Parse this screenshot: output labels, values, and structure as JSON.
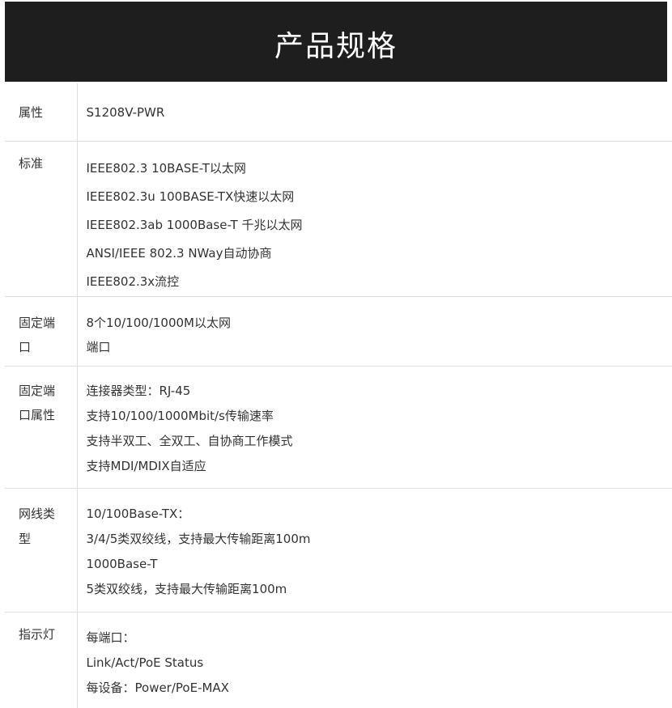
{
  "banner": {
    "title": "产品规格"
  },
  "rows": [
    {
      "attr": [
        "属性"
      ],
      "lines": [
        "S1208V-PWR"
      ]
    },
    {
      "attr": [
        "标准"
      ],
      "lines": [
        "IEEE802.3 10BASE-T以太网",
        "IEEE802.3u 100BASE-TX快速以太网",
        "IEEE802.3ab 1000Base-T 千兆以太网",
        "ANSI/IEEE 802.3 NWay自动协商",
        "IEEE802.3x流控"
      ]
    },
    {
      "attr": [
        "固定端",
        "口"
      ],
      "lines": [
        "8个10/100/1000M以太网",
        "端口"
      ]
    },
    {
      "attr": [
        "固定端",
        "口属性"
      ],
      "lines": [
        "连接器类型：RJ-45",
        "支持10/100/1000Mbit/s传输速率",
        "支持半双工、全双工、自协商工作模式",
        "支持MDI/MDIX自适应"
      ]
    },
    {
      "attr": [
        "网线类",
        "型"
      ],
      "lines": [
        "10/100Base-TX：",
        "3/4/5类双绞线，支持最大传输距离100m",
        "1000Base-T",
        "5类双绞线，支持最大传输距离100m"
      ]
    },
    {
      "attr": [
        "指示灯"
      ],
      "lines": [
        "每端口：",
        "Link/Act/PoE Status",
        "每设备：Power/PoE-MAX"
      ]
    }
  ]
}
